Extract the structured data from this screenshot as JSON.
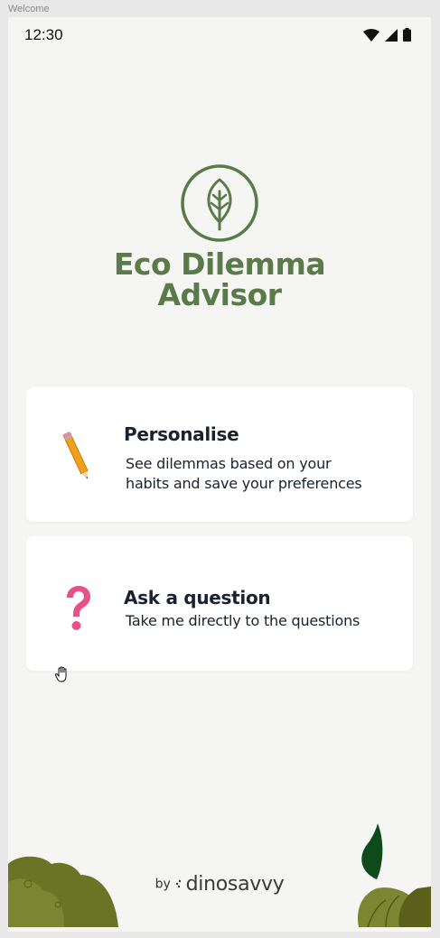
{
  "window": {
    "title": "Welcome"
  },
  "status_bar": {
    "time": "12:30",
    "icons": [
      "wifi-icon",
      "signal-icon",
      "battery-icon"
    ]
  },
  "app": {
    "title_line1": "Eco Dilemma",
    "title_line2": "Advisor",
    "logo": "leaf-icon"
  },
  "cards": [
    {
      "icon": "pencil-icon",
      "title": "Personalise",
      "desc_line1": "See dilemmas based on your",
      "desc_line2": "habits and save your preferences"
    },
    {
      "icon": "question-mark-icon",
      "title": "Ask a question",
      "desc_line1": "Take me directly to the questions"
    }
  ],
  "footer": {
    "by": "by",
    "brand": "dinosavvy"
  },
  "colors": {
    "brand_green": "#5a7a4a",
    "background": "#f5f6f4",
    "card": "#ffffff",
    "text": "#1a2230"
  }
}
